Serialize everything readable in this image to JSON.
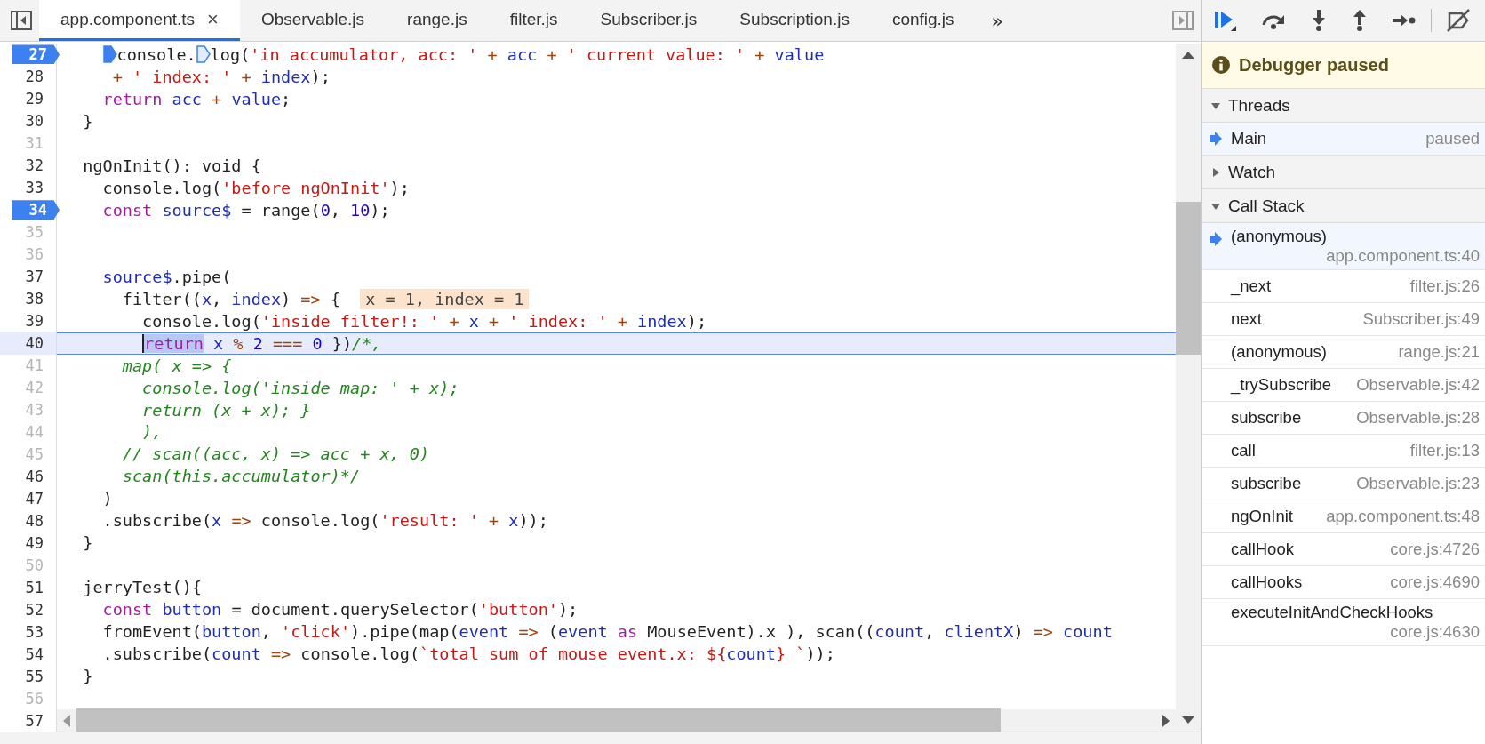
{
  "tabs": [
    {
      "label": "app.component.ts",
      "selected": true,
      "close": "×"
    },
    {
      "label": "Observable.js",
      "selected": false
    },
    {
      "label": "range.js",
      "selected": false
    },
    {
      "label": "filter.js",
      "selected": false
    },
    {
      "label": "Subscriber.js",
      "selected": false
    },
    {
      "label": "Subscription.js",
      "selected": false
    },
    {
      "label": "config.js",
      "selected": false
    }
  ],
  "more_tabs": "»",
  "editor": {
    "lines": [
      {
        "number": "27",
        "breakpoint": true,
        "dimmed": false,
        "current": false,
        "tokens": [
          {
            "kind": "marker",
            "active": true,
            "text": "    console."
          },
          {
            "kind": "marker",
            "active": false,
            "text": "log("
          },
          {
            "kind": "string",
            "text": "'in accumulator, acc: '"
          },
          {
            "kind": "operator",
            "text": " + "
          },
          {
            "kind": "variable",
            "text": "acc"
          },
          {
            "kind": "operator",
            "text": " + "
          },
          {
            "kind": "string",
            "text": "' current value: '"
          },
          {
            "kind": "operator",
            "text": " + "
          },
          {
            "kind": "variable",
            "text": "value"
          }
        ]
      },
      {
        "number": "28",
        "breakpoint": false,
        "dimmed": false,
        "current": false,
        "tokens": [
          {
            "kind": "operator",
            "text": "     + "
          },
          {
            "kind": "string",
            "text": "' index: '"
          },
          {
            "kind": "operator",
            "text": " + "
          },
          {
            "kind": "variable",
            "text": "index"
          },
          {
            "kind": "plain",
            "text": ");"
          }
        ]
      },
      {
        "number": "29",
        "breakpoint": false,
        "dimmed": false,
        "current": false,
        "tokens": [
          {
            "kind": "keyword",
            "text": "    return"
          },
          {
            "kind": "variable",
            "text": " acc"
          },
          {
            "kind": "operator",
            "text": " + "
          },
          {
            "kind": "variable",
            "text": "value"
          },
          {
            "kind": "plain",
            "text": ";"
          }
        ]
      },
      {
        "number": "30",
        "breakpoint": false,
        "dimmed": false,
        "current": false,
        "tokens": [
          {
            "kind": "plain",
            "text": "  }"
          }
        ]
      },
      {
        "number": "31",
        "breakpoint": false,
        "dimmed": true,
        "current": false
      },
      {
        "number": "32",
        "breakpoint": false,
        "dimmed": false,
        "current": false,
        "tokens": [
          {
            "kind": "plain",
            "text": "  ngOnInit(): void {"
          }
        ]
      },
      {
        "number": "33",
        "breakpoint": false,
        "dimmed": false,
        "current": false,
        "tokens": [
          {
            "kind": "plain",
            "text": "    console.log("
          },
          {
            "kind": "string",
            "text": "'before ngOnInit'"
          },
          {
            "kind": "plain",
            "text": ");"
          }
        ]
      },
      {
        "number": "34",
        "breakpoint": true,
        "dimmed": false,
        "current": false,
        "tokens": [
          {
            "kind": "keyword",
            "text": "    const"
          },
          {
            "kind": "variable",
            "text": " source$"
          },
          {
            "kind": "plain",
            "text": " = range("
          },
          {
            "kind": "number",
            "text": "0"
          },
          {
            "kind": "plain",
            "text": ", "
          },
          {
            "kind": "number",
            "text": "10"
          },
          {
            "kind": "plain",
            "text": ");"
          }
        ]
      },
      {
        "number": "35",
        "breakpoint": false,
        "dimmed": true,
        "current": false
      },
      {
        "number": "36",
        "breakpoint": false,
        "dimmed": true,
        "current": false
      },
      {
        "number": "37",
        "breakpoint": false,
        "dimmed": false,
        "current": false,
        "tokens": [
          {
            "kind": "variable",
            "text": "    source$"
          },
          {
            "kind": "plain",
            "text": ".pipe("
          }
        ]
      },
      {
        "number": "38",
        "breakpoint": false,
        "dimmed": false,
        "current": false,
        "tokens": [
          {
            "kind": "plain",
            "text": "      filter(("
          },
          {
            "kind": "variable",
            "text": "x"
          },
          {
            "kind": "plain",
            "text": ", "
          },
          {
            "kind": "variable",
            "text": "index"
          },
          {
            "kind": "plain",
            "text": ")"
          },
          {
            "kind": "operator",
            "text": " => "
          },
          {
            "kind": "plain",
            "text": "{  "
          },
          {
            "kind": "inline",
            "text": "x = 1, index = 1"
          }
        ]
      },
      {
        "number": "39",
        "breakpoint": false,
        "dimmed": false,
        "current": false,
        "tokens": [
          {
            "kind": "plain",
            "text": "        console.log("
          },
          {
            "kind": "string",
            "text": "'inside filter!: '"
          },
          {
            "kind": "operator",
            "text": " + "
          },
          {
            "kind": "variable",
            "text": "x"
          },
          {
            "kind": "operator",
            "text": " + "
          },
          {
            "kind": "string",
            "text": "' index: '"
          },
          {
            "kind": "operator",
            "text": " + "
          },
          {
            "kind": "variable",
            "text": "index"
          },
          {
            "kind": "plain",
            "text": ");"
          }
        ]
      },
      {
        "number": "40",
        "breakpoint": false,
        "dimmed": false,
        "current": true,
        "tokens": [
          {
            "kind": "selection",
            "text": "        return"
          },
          {
            "kind": "variable",
            "text": " x"
          },
          {
            "kind": "operator",
            "text": " % "
          },
          {
            "kind": "number",
            "text": "2"
          },
          {
            "kind": "operator",
            "text": " === "
          },
          {
            "kind": "number",
            "text": "0"
          },
          {
            "kind": "plain",
            "text": " })"
          },
          {
            "kind": "comment",
            "text": "/*,"
          }
        ]
      },
      {
        "number": "41",
        "breakpoint": false,
        "dimmed": true,
        "current": false,
        "tokens": [
          {
            "kind": "comment",
            "text": "      map( x => {"
          }
        ]
      },
      {
        "number": "42",
        "breakpoint": false,
        "dimmed": true,
        "current": false,
        "tokens": [
          {
            "kind": "comment",
            "text": "        console.log('inside map: ' + x);"
          }
        ]
      },
      {
        "number": "43",
        "breakpoint": false,
        "dimmed": true,
        "current": false,
        "tokens": [
          {
            "kind": "comment",
            "text": "        return (x + x); }"
          }
        ]
      },
      {
        "number": "44",
        "breakpoint": false,
        "dimmed": true,
        "current": false,
        "tokens": [
          {
            "kind": "comment",
            "text": "        ),"
          }
        ]
      },
      {
        "number": "45",
        "breakpoint": false,
        "dimmed": true,
        "current": false,
        "tokens": [
          {
            "kind": "comment",
            "text": "      // scan((acc, x) => acc + x, 0)"
          }
        ]
      },
      {
        "number": "46",
        "breakpoint": false,
        "dimmed": false,
        "current": false,
        "tokens": [
          {
            "kind": "comment",
            "text": "      scan(this.accumulator)*/"
          }
        ]
      },
      {
        "number": "47",
        "breakpoint": false,
        "dimmed": false,
        "current": false,
        "tokens": [
          {
            "kind": "plain",
            "text": "    )"
          }
        ]
      },
      {
        "number": "48",
        "breakpoint": false,
        "dimmed": false,
        "current": false,
        "tokens": [
          {
            "kind": "plain",
            "text": "    .subscribe("
          },
          {
            "kind": "variable",
            "text": "x"
          },
          {
            "kind": "operator",
            "text": " => "
          },
          {
            "kind": "plain",
            "text": "console.log("
          },
          {
            "kind": "string",
            "text": "'result: '"
          },
          {
            "kind": "operator",
            "text": " + "
          },
          {
            "kind": "variable",
            "text": "x"
          },
          {
            "kind": "plain",
            "text": "));"
          }
        ]
      },
      {
        "number": "49",
        "breakpoint": false,
        "dimmed": false,
        "current": false,
        "tokens": [
          {
            "kind": "plain",
            "text": "  }"
          }
        ]
      },
      {
        "number": "50",
        "breakpoint": false,
        "dimmed": true,
        "current": false
      },
      {
        "number": "51",
        "breakpoint": false,
        "dimmed": false,
        "current": false,
        "tokens": [
          {
            "kind": "plain",
            "text": "  jerryTest(){"
          }
        ]
      },
      {
        "number": "52",
        "breakpoint": false,
        "dimmed": false,
        "current": false,
        "tokens": [
          {
            "kind": "keyword",
            "text": "    const"
          },
          {
            "kind": "variable",
            "text": " button"
          },
          {
            "kind": "plain",
            "text": " = document.querySelector("
          },
          {
            "kind": "string",
            "text": "'button'"
          },
          {
            "kind": "plain",
            "text": ");"
          }
        ]
      },
      {
        "number": "53",
        "breakpoint": false,
        "dimmed": false,
        "current": false,
        "tokens": [
          {
            "kind": "plain",
            "text": "    fromEvent("
          },
          {
            "kind": "variable",
            "text": "button"
          },
          {
            "kind": "plain",
            "text": ", "
          },
          {
            "kind": "string",
            "text": "'click'"
          },
          {
            "kind": "plain",
            "text": ").pipe(map("
          },
          {
            "kind": "variable",
            "text": "event"
          },
          {
            "kind": "operator",
            "text": " => "
          },
          {
            "kind": "plain",
            "text": "("
          },
          {
            "kind": "variable",
            "text": "event"
          },
          {
            "kind": "keyword",
            "text": " as"
          },
          {
            "kind": "plain",
            "text": " MouseEvent).x ), scan(("
          },
          {
            "kind": "variable",
            "text": "count"
          },
          {
            "kind": "plain",
            "text": ", "
          },
          {
            "kind": "variable",
            "text": "clientX"
          },
          {
            "kind": "plain",
            "text": ")"
          },
          {
            "kind": "operator",
            "text": " => "
          },
          {
            "kind": "variable",
            "text": "count"
          }
        ]
      },
      {
        "number": "54",
        "breakpoint": false,
        "dimmed": false,
        "current": false,
        "tokens": [
          {
            "kind": "plain",
            "text": "    .subscribe("
          },
          {
            "kind": "variable",
            "text": "count"
          },
          {
            "kind": "operator",
            "text": " => "
          },
          {
            "kind": "plain",
            "text": "console.log("
          },
          {
            "kind": "string",
            "text": "`total sum of mouse event.x: ${"
          },
          {
            "kind": "variable",
            "text": "count"
          },
          {
            "kind": "string",
            "text": "} `"
          },
          {
            "kind": "plain",
            "text": "));"
          }
        ]
      },
      {
        "number": "55",
        "breakpoint": false,
        "dimmed": false,
        "current": false,
        "tokens": [
          {
            "kind": "plain",
            "text": "  }"
          }
        ]
      },
      {
        "number": "56",
        "breakpoint": false,
        "dimmed": true,
        "current": false
      },
      {
        "number": "57",
        "breakpoint": false,
        "dimmed": false,
        "current": false
      }
    ]
  },
  "debugger": {
    "banner": "Debugger paused",
    "sections": [
      {
        "title": "Threads",
        "expanded": true,
        "kind": "threads",
        "items": [
          {
            "name": "Main",
            "status": "paused",
            "current": true
          }
        ]
      },
      {
        "title": "Watch",
        "expanded": false
      },
      {
        "title": "Call Stack",
        "expanded": true,
        "kind": "frames",
        "items": [
          {
            "name": "(anonymous)",
            "location": "app.component.ts:40",
            "current": true
          },
          {
            "name": "_next",
            "location": "filter.js:26",
            "current": false
          },
          {
            "name": "next",
            "location": "Subscriber.js:49",
            "current": false
          },
          {
            "name": "(anonymous)",
            "location": "range.js:21",
            "current": false
          },
          {
            "name": "_trySubscribe",
            "location": "Observable.js:42",
            "current": false
          },
          {
            "name": "subscribe",
            "location": "Observable.js:28",
            "current": false
          },
          {
            "name": "call",
            "location": "filter.js:13",
            "current": false
          },
          {
            "name": "subscribe",
            "location": "Observable.js:23",
            "current": false
          },
          {
            "name": "ngOnInit",
            "location": "app.component.ts:48",
            "current": false
          },
          {
            "name": "callHook",
            "location": "core.js:4726",
            "current": false
          },
          {
            "name": "callHooks",
            "location": "core.js:4690",
            "current": false
          },
          {
            "name": "executeInitAndCheckHooks",
            "location": "core.js:4630",
            "current": false
          }
        ]
      }
    ]
  }
}
